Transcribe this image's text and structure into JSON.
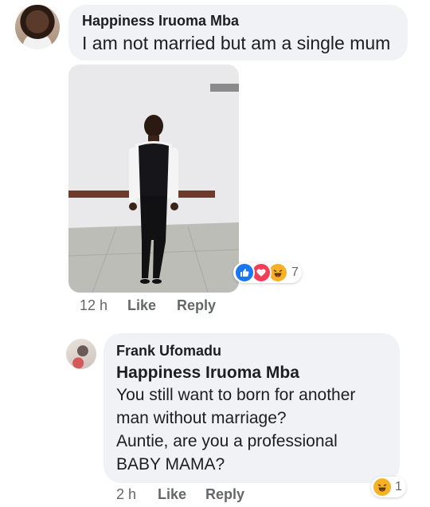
{
  "comment1": {
    "author": "Happiness Iruoma Mba",
    "text": "I am not married but am a single mum",
    "time": "12 h",
    "like_label": "Like",
    "reply_label": "Reply",
    "reaction_count": "7",
    "reaction_icons": [
      "like-icon",
      "love-icon",
      "haha-icon"
    ]
  },
  "comment2": {
    "author": "Frank Ufomadu",
    "mention": "Happiness Iruoma Mba",
    "text_lines": [
      "You still want to born for another",
      "man without marriage?",
      "Auntie, are you a professional",
      "BABY MAMA?"
    ],
    "time": "2 h",
    "like_label": "Like",
    "reply_label": "Reply",
    "reaction_count": "1",
    "reaction_icons": [
      "haha-icon"
    ]
  },
  "colors": {
    "bubble": "#f0f2f5",
    "meta_text": "#65676b",
    "like_blue": "#1877f2",
    "love_red": "#f33e58",
    "haha_yellow": "#f7b125"
  }
}
